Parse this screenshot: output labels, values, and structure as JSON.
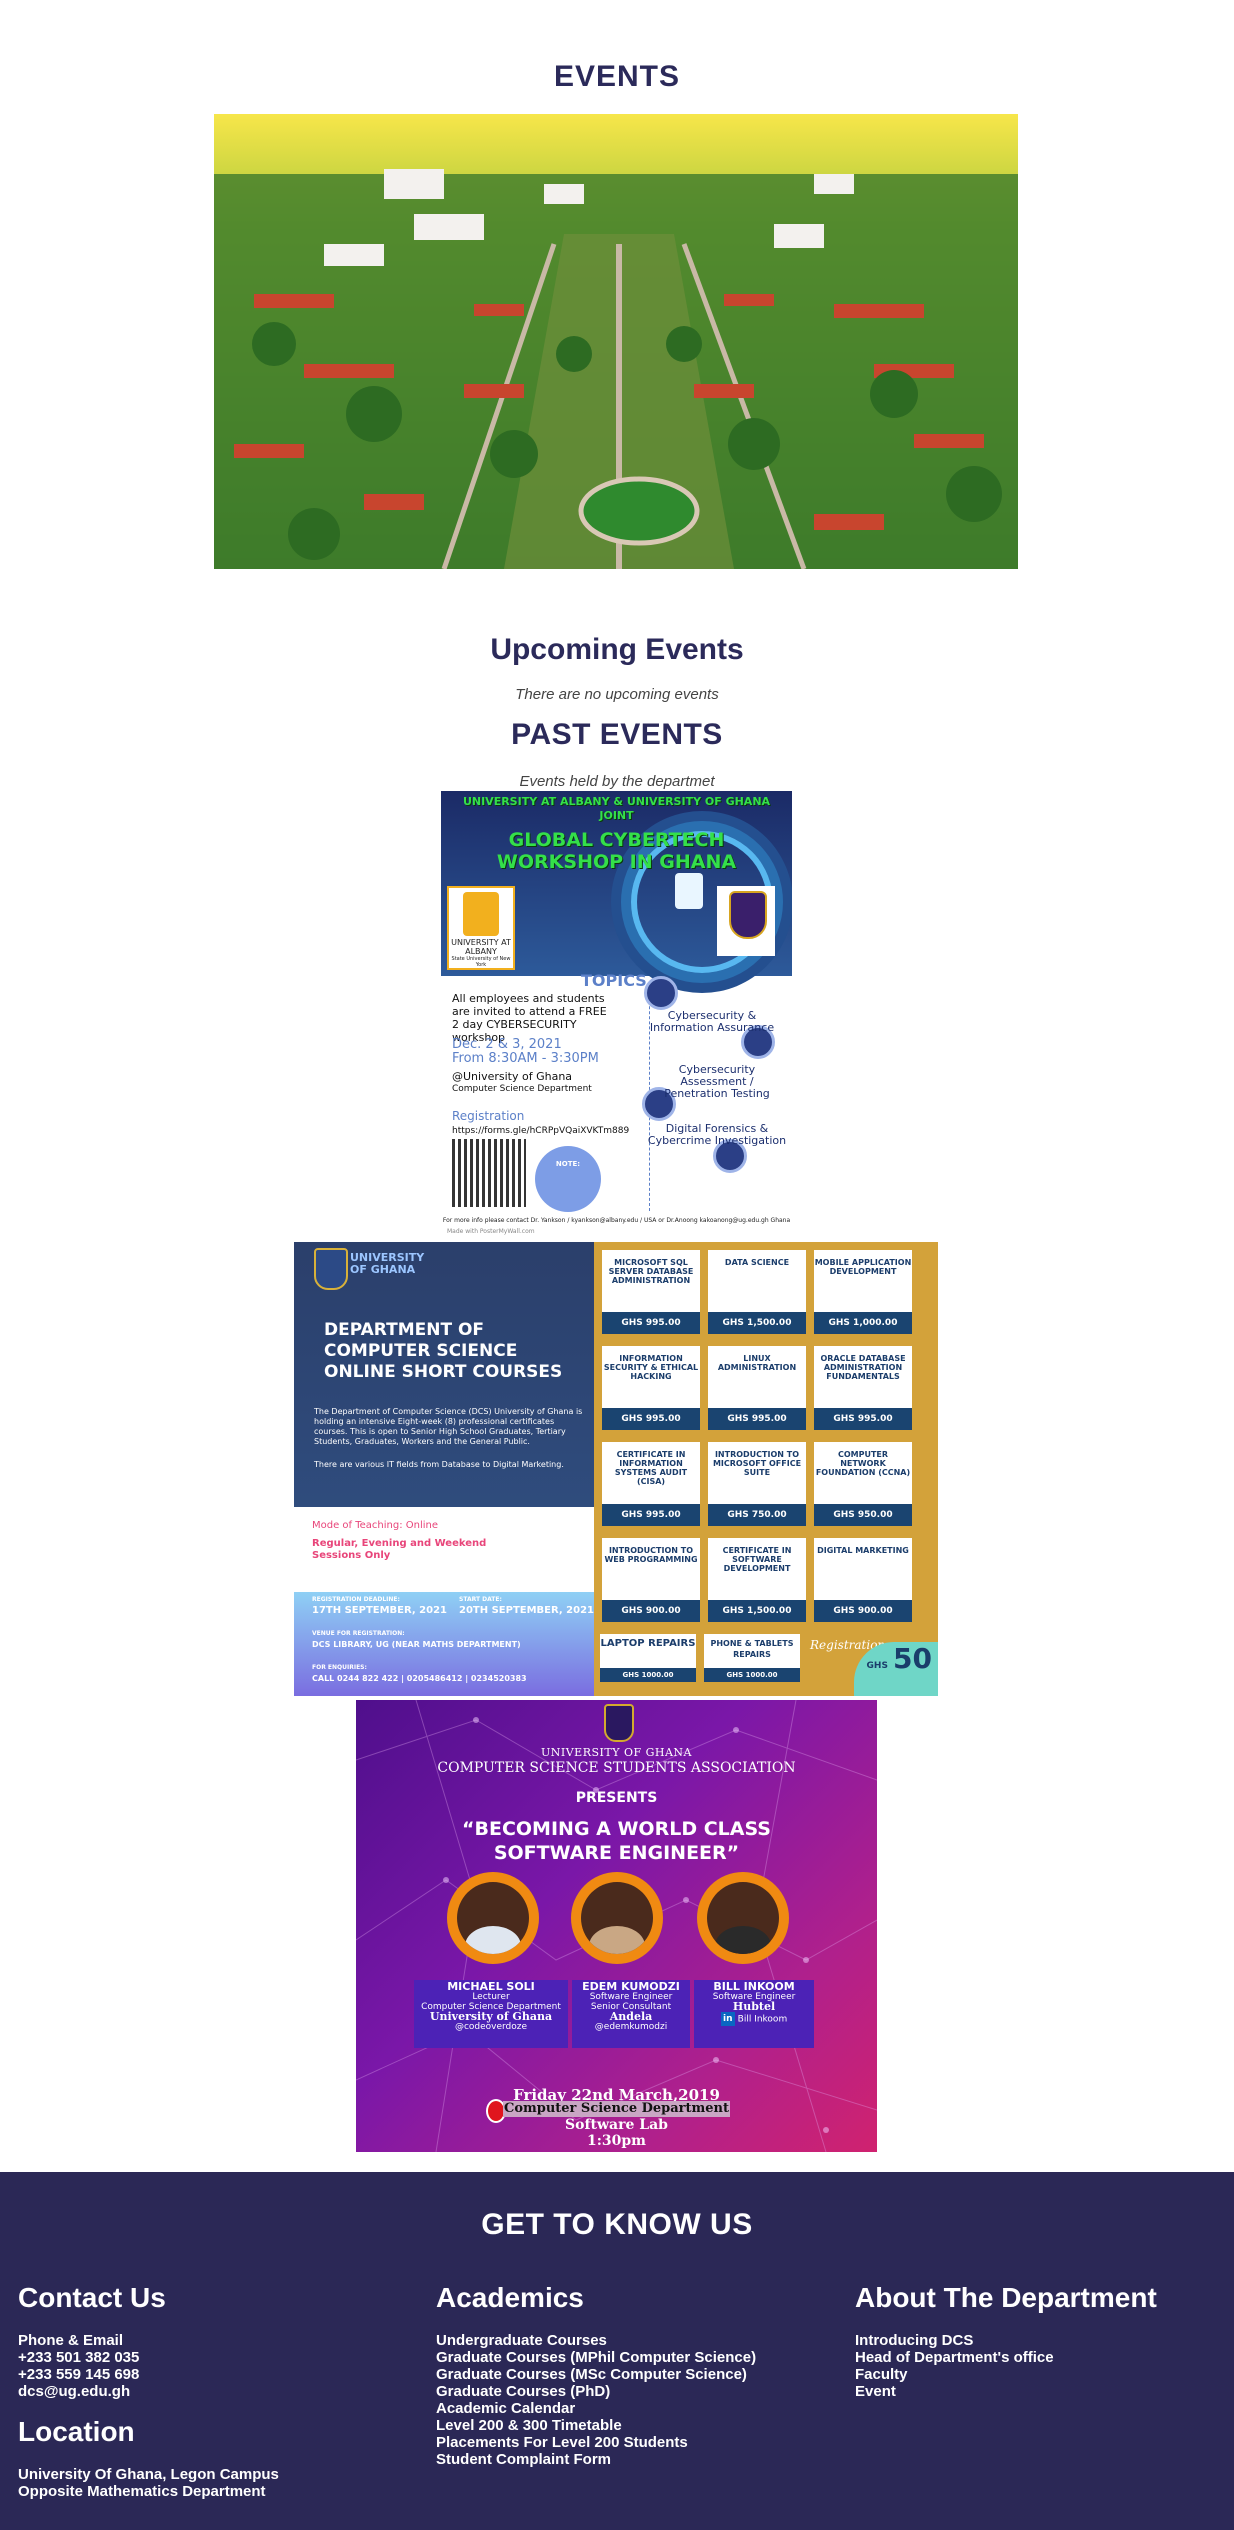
{
  "header": {
    "title": "EVENTS"
  },
  "upcoming": {
    "title": "Upcoming Events",
    "empty_message": "There are no upcoming events"
  },
  "past": {
    "title": "PAST EVENTS",
    "subtitle": "Events held by the departmet"
  },
  "flyer1": {
    "line1": "UNIVERSITY AT ALBANY & UNIVERSITY OF GHANA",
    "line2": "JOINT",
    "line3": "GLOBAL CYBERTECH",
    "line4": "WORKSHOP IN GHANA",
    "albany_logo": "UNIVERSITY AT ALBANY",
    "albany_sub": "State University of New York",
    "topics_label": "TOPICS",
    "topic1": "Cybersecurity & Information Assurance",
    "topic2": "Cybersecurity Assessment / Penetration Testing",
    "topic3": "Digital Forensics & Cybercrime Investigation",
    "invite": "All employees and students are invited to attend a FREE 2 day CYBERSECURITY workshop",
    "date": "Dec. 2 & 3, 2021",
    "time": "From 8:30AM - 3:30PM",
    "venue1": "@University of Ghana",
    "venue2": "Computer Science Department",
    "registration_label": "Registration",
    "registration_url": "https://forms.gle/hCRPpVQaiXVKTm889",
    "note_label": "NOTE:",
    "contact": "For more info please contact Dr. Yankson / kyankson@albany.edu / USA or Dr.Anoong kakoanong@ug.edu.gh Ghana",
    "made_with": "Made with PosterMyWall.com"
  },
  "flyer2": {
    "ug_name": "UNIVERSITY OF GHANA",
    "title1": "DEPARTMENT OF",
    "title2": "COMPUTER SCIENCE",
    "title3": "ONLINE SHORT COURSES",
    "body1": "The Department of Computer Science (DCS) University of Ghana is holding an intensive Eight-week (8) professional certificates courses. This is open to Senior High School Graduates, Tertiary Students, Graduates, Workers and the General Public.",
    "body2": "There are various IT fields from Database to Digital Marketing.",
    "mode": "Mode of Teaching: Online",
    "sessions1": "Regular, Evening and Weekend",
    "sessions2": "Sessions Only",
    "deadline_label": "REGISTRATION DEADLINE:",
    "deadline": "17TH SEPTEMBER, 2021",
    "start_label": "START DATE:",
    "start": "20TH SEPTEMBER, 2021",
    "venue_label": "VENUE FOR REGISTRATION:",
    "venue": "DCS LIBRARY, UG (NEAR MATHS DEPARTMENT)",
    "enq_label": "FOR ENQUIRIES:",
    "enq": "CALL 0244 822 422 | 0205486412 | 0234520383",
    "courses": [
      {
        "name": "MICROSOFT SQL SERVER DATABASE ADMINISTRATION",
        "price": "GHS 995.00"
      },
      {
        "name": "DATA SCIENCE",
        "price": "GHS 1,500.00"
      },
      {
        "name": "MOBILE APPLICATION DEVELOPMENT",
        "price": "GHS 1,000.00"
      },
      {
        "name": "INFORMATION SECURITY & ETHICAL HACKING",
        "price": "GHS 995.00"
      },
      {
        "name": "LINUX ADMINISTRATION",
        "price": "GHS 995.00"
      },
      {
        "name": "ORACLE DATABASE ADMINISTRATION FUNDAMENTALS",
        "price": "GHS 995.00"
      },
      {
        "name": "CERTIFICATE IN INFORMATION SYSTEMS AUDIT (CISA)",
        "price": "GHS 995.00"
      },
      {
        "name": "INTRODUCTION TO MICROSOFT OFFICE SUITE",
        "price": "GHS 750.00"
      },
      {
        "name": "COMPUTER NETWORK FOUNDATION (CCNA)",
        "price": "GHS 950.00"
      },
      {
        "name": "INTRODUCTION TO WEB PROGRAMMING",
        "price": "GHS 900.00"
      },
      {
        "name": "CERTIFICATE IN SOFTWARE DEVELOPMENT",
        "price": "GHS 1,500.00"
      },
      {
        "name": "DIGITAL MARKETING",
        "price": "GHS 900.00"
      }
    ],
    "extra1": {
      "name": "LAPTOP REPAIRS",
      "price": "GHS 1000.00"
    },
    "extra2": {
      "name": "PHONE & TABLETS REPAIRS",
      "price": "GHS 1000.00"
    },
    "reg_label": "Registration",
    "reg_currency": "GHS",
    "reg_fee": "50"
  },
  "flyer3": {
    "ug": "UNIVERSITY OF GHANA",
    "assoc": "COMPUTER SCIENCE STUDENTS ASSOCIATION",
    "presents": "PRESENTS",
    "talk1": "“BECOMING A WORLD CLASS",
    "talk2": "SOFTWARE ENGINEER”",
    "speakers": [
      {
        "name": "MICHAEL SOLI",
        "role1": "Lecturer",
        "role2": "Computer Science Department",
        "org": "University of Ghana",
        "handle": "@codeoverdoze"
      },
      {
        "name": "EDEM KUMODZI",
        "role1": "Software Engineer",
        "role2": "Senior Consultant",
        "org": "Andela",
        "handle": "@edemkumodzi"
      },
      {
        "name": "BILL INKOOM",
        "role1": "Software Engineer",
        "role2": "",
        "org": "Hubtel",
        "handle": "Bill Inkoom"
      }
    ],
    "date": "Friday 22nd March,2019",
    "venue": "Computer Science Department",
    "lab": "Software Lab",
    "time": "1:30pm"
  },
  "footer": {
    "title": "GET TO KNOW US",
    "contact": {
      "heading": "Contact Us",
      "lines": [
        "Phone & Email",
        "+233 501 382 035",
        "+233 559 145 698",
        "dcs@ug.edu.gh"
      ]
    },
    "location": {
      "heading": "Location",
      "lines": [
        "University Of Ghana, Legon Campus",
        "Opposite Mathematics Department"
      ]
    },
    "academics": {
      "heading": "Academics",
      "links": [
        "Undergraduate Courses",
        "Graduate Courses (MPhil Computer Science)",
        "Graduate Courses (MSc Computer Science)",
        "Graduate Courses (PhD)",
        "Academic Calendar",
        "Level 200 & 300 Timetable",
        "Placements For Level 200 Students",
        "Student Complaint Form"
      ]
    },
    "about": {
      "heading": "About The Department",
      "links": [
        "Introducing DCS",
        "Head of Department's office",
        "Faculty",
        "Event"
      ]
    }
  }
}
